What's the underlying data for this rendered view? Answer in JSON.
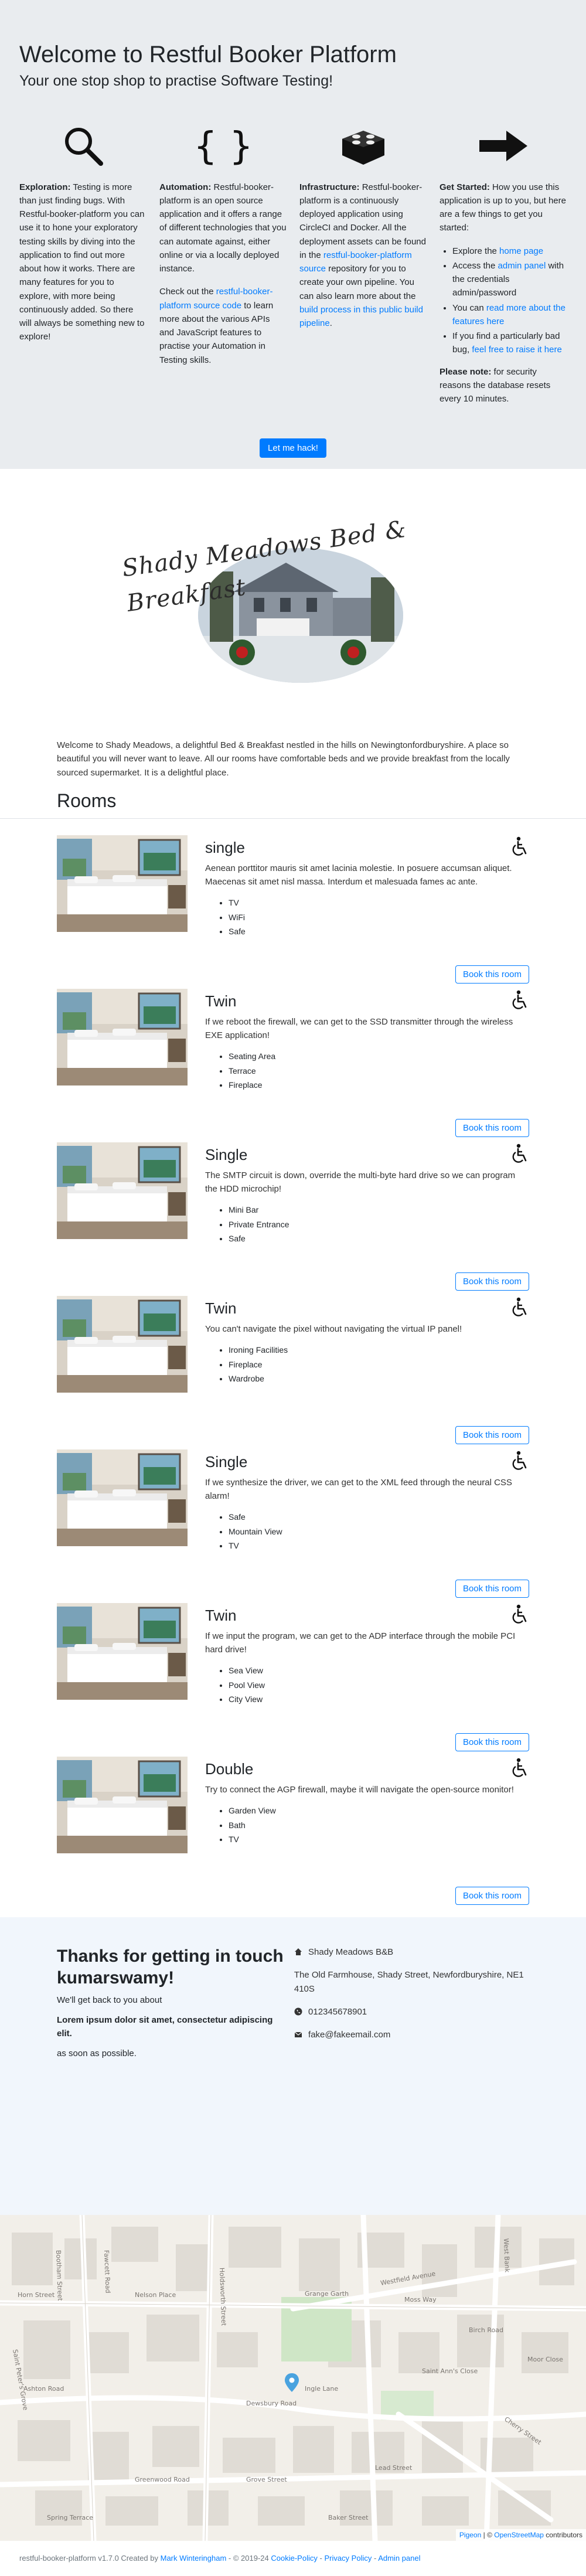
{
  "hero": {
    "title": "Welcome to Restful Booker Platform",
    "subtitle": "Your one stop shop to practise Software Testing!",
    "icons": [
      "search-icon",
      "braces-icon",
      "lego-brick-icon",
      "arrow-right-icon"
    ],
    "exploration": {
      "label": "Exploration:",
      "text": " Testing is more than just finding bugs. With Restful-booker-platform you can use it to hone your exploratory testing skills by diving into the application to find out more about how it works. There are many features for you to explore, with more being continuously added. So there will always be something new to explore!"
    },
    "automation": {
      "label": "Automation:",
      "text": " Restful-booker-platform is an open source application and it offers a range of different technologies that you can automate against, either online or via a locally deployed instance.",
      "p2_before": "Check out the ",
      "p2_link": "restful-booker-platform source code",
      "p2_after": " to learn more about the various APIs and JavaScript features to practise your Automation in Testing skills."
    },
    "infrastructure": {
      "label": "Infrastructure:",
      "text_before": " Restful-booker-platform is a continuously deployed application using CircleCI and Docker. All the deployment assets can be found in the ",
      "link1": "restful-booker-platform source",
      "text_mid": " repository for you to create your own pipeline. You can also learn more about the ",
      "link2": "build process in this public build pipeline",
      "text_after": "."
    },
    "getting_started": {
      "label": "Get Started:",
      "text": " How you use this application is up to you, but here are a few things to get you started:",
      "items": [
        {
          "before": "Explore the ",
          "link": "home page",
          "after": ""
        },
        {
          "before": "Access the ",
          "link": "admin panel",
          "after": " with the credentials admin/password"
        },
        {
          "before": "You can ",
          "link": "read more about the features here",
          "after": ""
        },
        {
          "before": "If you find a particularly bad bug, ",
          "link": "feel free to raise it here",
          "after": ""
        }
      ],
      "note_label": "Please note:",
      "note_text": " for security reasons the database resets every 10 minutes."
    },
    "hack_button": "Let me hack!"
  },
  "hotel": {
    "logo_text": "Shady Meadows Bed & Breakfast",
    "intro": "Welcome to Shady Meadows, a delightful Bed & Breakfast nestled in the hills on Newingtonfordburyshire. A place so beautiful you will never want to leave. All our rooms have comfortable beds and we provide breakfast from the locally sourced supermarket. It is a delightful place.",
    "rooms_title": "Rooms",
    "book_label": "Book this room"
  },
  "rooms": [
    {
      "name": "single",
      "desc": "Aenean porttitor mauris sit amet lacinia molestie. In posuere accumsan aliquet. Maecenas sit amet nisl massa. Interdum et malesuada fames ac ante.",
      "features": [
        "TV",
        "WiFi",
        "Safe"
      ]
    },
    {
      "name": "Twin",
      "desc": "If we reboot the firewall, we can get to the SSD transmitter through the wireless EXE application!",
      "features": [
        "Seating Area",
        "Terrace",
        "Fireplace"
      ]
    },
    {
      "name": "Single",
      "desc": "The SMTP circuit is down, override the multi-byte hard drive so we can program the HDD microchip!",
      "features": [
        "Mini Bar",
        "Private Entrance",
        "Safe"
      ]
    },
    {
      "name": "Twin",
      "desc": "You can't navigate the pixel without navigating the virtual IP panel!",
      "features": [
        "Ironing Facilities",
        "Fireplace",
        "Wardrobe"
      ]
    },
    {
      "name": "Single",
      "desc": "If we synthesize the driver, we can get to the XML feed through the neural CSS alarm!",
      "features": [
        "Safe",
        "Mountain View",
        "TV"
      ]
    },
    {
      "name": "Twin",
      "desc": "If we input the program, we can get to the ADP interface through the mobile PCI hard drive!",
      "features": [
        "Sea View",
        "Pool View",
        "City View"
      ]
    },
    {
      "name": "Double",
      "desc": "Try to connect the AGP firewall, maybe it will navigate the open-source monitor!",
      "features": [
        "Garden View",
        "Bath",
        "TV"
      ]
    }
  ],
  "contact": {
    "title": "Thanks for getting in touch kumarswamy!",
    "line1": "We'll get back to you about",
    "subject": "Lorem ipsum dolor sit amet, consectetur adipiscing elit.",
    "line2": "as soon as possible.",
    "name": "Shady Meadows B&B",
    "address": "The Old Farmhouse, Shady Street, Newfordburyshire, NE1 410S",
    "phone": "012345678901",
    "email": "fake@fakeemail.com"
  },
  "map": {
    "attribution_link": "Pigeon",
    "attribution_sep": " | © ",
    "attribution_osm": "OpenStreetMap",
    "attribution_after": " contributors",
    "streets": [
      "Saint Peter's Grove",
      "Fawcett Road",
      "Dewsbury Road",
      "Holdsworth Street",
      "Bootham Street",
      "West Bank",
      "Moss Way",
      "Grange Garth",
      "Saint Ann's Close",
      "Ashton Road",
      "Westfield Avenue",
      "Birch Road",
      "Greenwood Road",
      "Horn Street",
      "Nelson Place",
      "Cherry Street",
      "Lead Street",
      "Grove Street",
      "Baker Street",
      "Ingle Lane",
      "Moor Close",
      "Spring Terrace"
    ]
  },
  "footer": {
    "text": "restful-booker-platform v1.7.0 Created by ",
    "author": "Mark Winteringham",
    "year": " - © 2019-24 ",
    "cookie": "Cookie-Policy",
    "sep": " - ",
    "privacy": "Privacy Policy",
    "admin": "Admin panel"
  }
}
